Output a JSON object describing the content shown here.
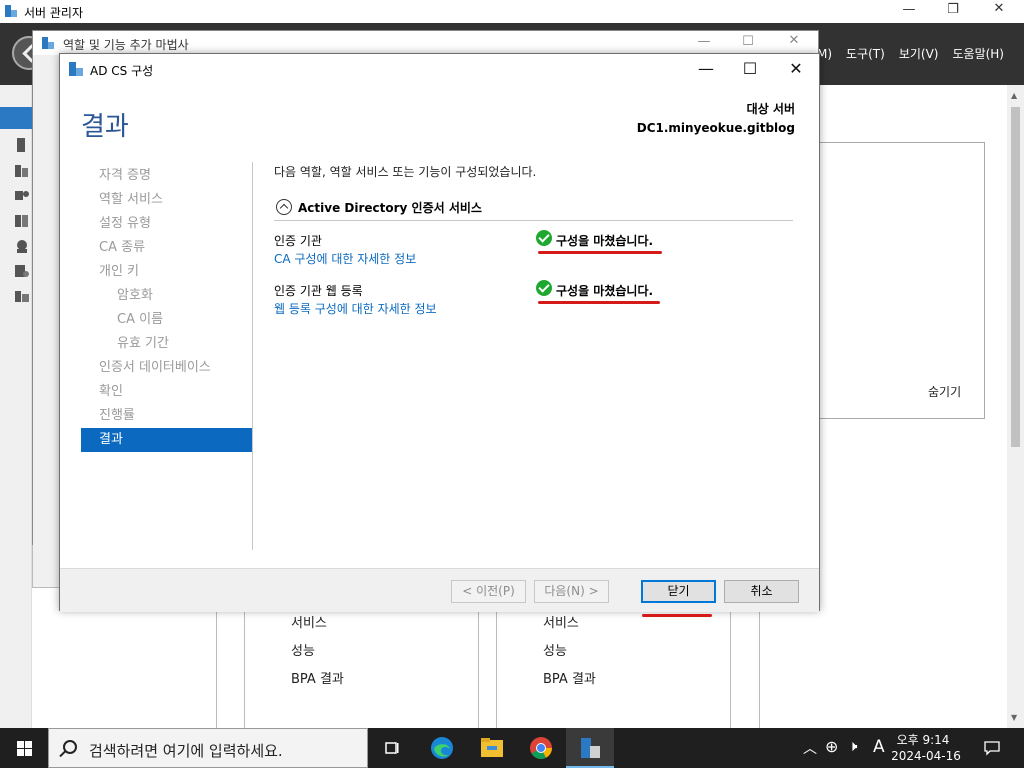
{
  "server_manager": {
    "title": "서버 관리자",
    "menu": [
      "관리(M)",
      "도구(T)",
      "보기(V)",
      "도움말(H)"
    ],
    "hide_label": "숨기기",
    "tiles": [
      {
        "items": [
          "서비스",
          "성능",
          "BPA 결과"
        ]
      },
      {
        "items": [
          "서비스",
          "성능",
          "BPA 결과"
        ]
      }
    ]
  },
  "wizard": {
    "title": "역할 및 기능 추가 마법사"
  },
  "dialog": {
    "title": "AD CS 구성",
    "heading": "결과",
    "target_label": "대상 서버",
    "target_server": "DC1.minyeokue.gitblog",
    "steps": [
      {
        "label": "자격 증명",
        "sub": false,
        "active": false
      },
      {
        "label": "역할 서비스",
        "sub": false,
        "active": false
      },
      {
        "label": "설정 유형",
        "sub": false,
        "active": false
      },
      {
        "label": "CA 종류",
        "sub": false,
        "active": false
      },
      {
        "label": "개인 키",
        "sub": false,
        "active": false
      },
      {
        "label": "암호화",
        "sub": true,
        "active": false
      },
      {
        "label": "CA 이름",
        "sub": true,
        "active": false
      },
      {
        "label": "유효 기간",
        "sub": true,
        "active": false
      },
      {
        "label": "인증서 데이터베이스",
        "sub": false,
        "active": false
      },
      {
        "label": "확인",
        "sub": false,
        "active": false
      },
      {
        "label": "진행률",
        "sub": false,
        "active": false
      },
      {
        "label": "결과",
        "sub": false,
        "active": true
      }
    ],
    "intro": "다음 역할, 역할 서비스 또는 기능이 구성되었습니다.",
    "section_title": "Active Directory 인증서 서비스",
    "results": [
      {
        "name": "인증 기관",
        "link": "CA 구성에 대한 자세한 정보",
        "status": "구성을 마쳤습니다."
      },
      {
        "name": "인증 기관 웹 등록",
        "link": "웹 등록 구성에 대한 자세한 정보",
        "status": "구성을 마쳤습니다."
      }
    ],
    "buttons": {
      "prev": "< 이전(P)",
      "next": "다음(N) >",
      "close": "닫기",
      "cancel": "취소"
    }
  },
  "taskbar": {
    "search_placeholder": "검색하려면 여기에 입력하세요.",
    "time": "오후 9:14",
    "date": "2024-04-16",
    "ime": "A"
  },
  "colors": {
    "accent": "#0b6ac0",
    "heading": "#2b5797",
    "success": "#1fa830",
    "annotation": "#d61a1a"
  }
}
